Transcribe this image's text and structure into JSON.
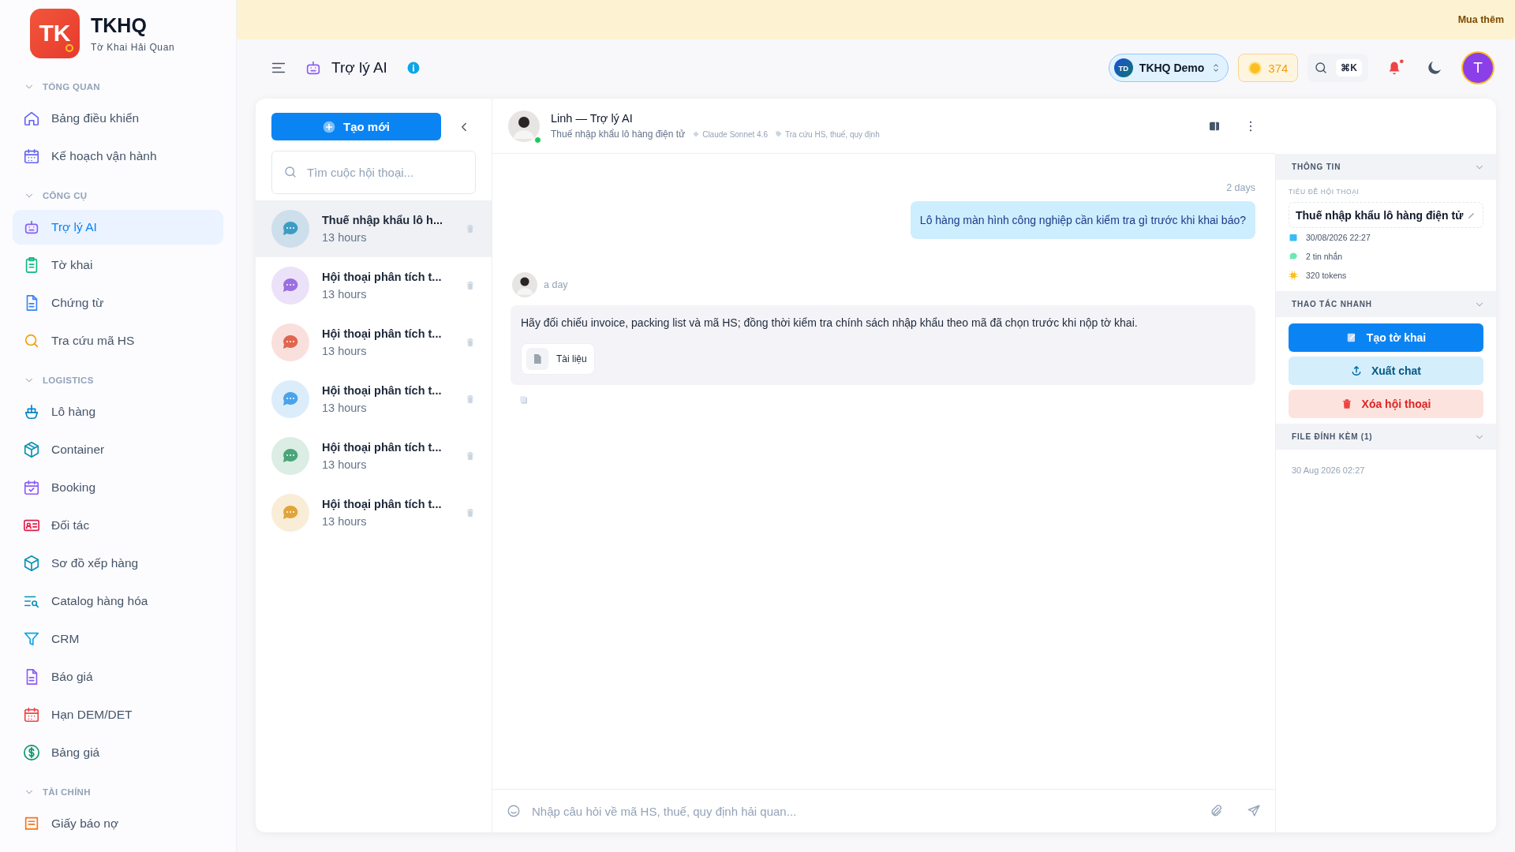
{
  "banner": {
    "action": "Mua thêm"
  },
  "brand": {
    "logo": "TK",
    "name": "TKHQ",
    "subtitle": "Tờ Khai Hải Quan"
  },
  "sidebar": {
    "sections": [
      {
        "title": "TỔNG QUAN",
        "items": [
          {
            "label": "Bảng điều khiển",
            "kind": "home",
            "color": "#6366f1",
            "selected": false
          },
          {
            "label": "Kế hoạch vận hành",
            "kind": "calendar",
            "color": "#6366f1",
            "selected": false
          }
        ]
      },
      {
        "title": "CÔNG CỤ",
        "items": [
          {
            "label": "Trợ lý AI",
            "kind": "robot",
            "color": "#8b5cf6",
            "selected": true
          },
          {
            "label": "Tờ khai",
            "kind": "clipboard",
            "color": "#10b981",
            "selected": false
          },
          {
            "label": "Chứng từ",
            "kind": "document",
            "color": "#3b82f6",
            "selected": false
          },
          {
            "label": "Tra cứu mã HS",
            "kind": "search",
            "color": "#f59e0b",
            "selected": false
          }
        ]
      },
      {
        "title": "LOGISTICS",
        "items": [
          {
            "label": "Lô hàng",
            "kind": "boat",
            "color": "#0284c7",
            "selected": false
          },
          {
            "label": "Container",
            "kind": "box",
            "color": "#0891b2",
            "selected": false
          },
          {
            "label": "Booking",
            "kind": "calendar-check",
            "color": "#8b5cf6",
            "selected": false
          },
          {
            "label": "Đối tác",
            "kind": "contact-card",
            "color": "#e11d48",
            "selected": false
          },
          {
            "label": "Sơ đồ xếp hàng",
            "kind": "cube",
            "color": "#0891b2",
            "selected": false
          },
          {
            "label": "Catalog hàng hóa",
            "kind": "list-search",
            "color": "#0891b2",
            "selected": false
          },
          {
            "label": "CRM",
            "kind": "funnel",
            "color": "#0ea5e9",
            "selected": false
          },
          {
            "label": "Báo giá",
            "kind": "document",
            "color": "#8b5cf6",
            "selected": false
          },
          {
            "label": "Hạn DEM/DET",
            "kind": "calendar",
            "color": "#ef4444",
            "selected": false
          },
          {
            "label": "Bảng giá",
            "kind": "dollar",
            "color": "#059669",
            "selected": false
          }
        ]
      },
      {
        "title": "TÀI CHÍNH",
        "items": [
          {
            "label": "Giấy báo nợ",
            "kind": "receipt",
            "color": "#f97316",
            "selected": false
          }
        ]
      }
    ]
  },
  "header": {
    "title": "Trợ lý AI",
    "workspace": {
      "badge": "TD",
      "name": "TKHQ Demo"
    },
    "credits": "374",
    "shortcut": "⌘K",
    "avatar": "T"
  },
  "chat_list": {
    "new_button": "Tạo mới",
    "search_placeholder": "Tìm cuộc hội thoại...",
    "items": [
      {
        "title": "Thuế nhập khẩu lô h...",
        "time": "13 hours",
        "color": "#3d9cc4",
        "selected": true
      },
      {
        "title": "Hội thoại phân tích t...",
        "time": "13 hours",
        "color": "#9b6fe0",
        "selected": false
      },
      {
        "title": "Hội thoại phân tích t...",
        "time": "13 hours",
        "color": "#e0664f",
        "selected": false
      },
      {
        "title": "Hội thoại phân tích t...",
        "time": "13 hours",
        "color": "#4aa3ea",
        "selected": false
      },
      {
        "title": "Hội thoại phân tích t...",
        "time": "13 hours",
        "color": "#4aa57a",
        "selected": false
      },
      {
        "title": "Hội thoại phân tích t...",
        "time": "13 hours",
        "color": "#e0a43a",
        "selected": false
      }
    ]
  },
  "conversation": {
    "assistant": "Linh — Trợ lý AI",
    "topic": "Thuế nhập khẩu lô hàng điện tử",
    "model": "Claude Sonnet 4.6",
    "scope": "Tra cứu HS, thuế, quy định",
    "messages": [
      {
        "kind": "user",
        "time": "2 days",
        "text": "Lô hàng màn hình công nghiệp cần kiểm tra gì trước khi khai báo?"
      },
      {
        "kind": "assistant",
        "time": "a day",
        "text": "Hãy đối chiếu invoice, packing list và mã HS; đồng thời kiểm tra chính sách nhập khẩu theo mã đã chọn trước khi nộp tờ khai.",
        "attachment": "Tài liệu"
      }
    ],
    "input_placeholder": "Nhập câu hỏi về mã HS, thuế, quy định hải quan..."
  },
  "info": {
    "heading": "THÔNG TIN",
    "title_label": "TIÊU ĐỀ HỘI THOẠI",
    "title": "Thuế nhập khẩu lô hàng điện tử",
    "created": "30/08/2026 22:27",
    "messages": "2 tin nhắn",
    "tokens": "320 tokens"
  },
  "actions": {
    "heading": "THAO TÁC NHANH",
    "buttons": [
      {
        "label": "Tạo tờ khai",
        "kind": "primary"
      },
      {
        "label": "Xuất chat",
        "kind": "secondary"
      },
      {
        "label": "Xóa hội thoại",
        "kind": "danger"
      }
    ]
  },
  "files": {
    "heading": "FILE ĐÍNH KÈM (1)",
    "items": [
      {
        "date": "30 Aug 2026 02:27"
      }
    ]
  }
}
